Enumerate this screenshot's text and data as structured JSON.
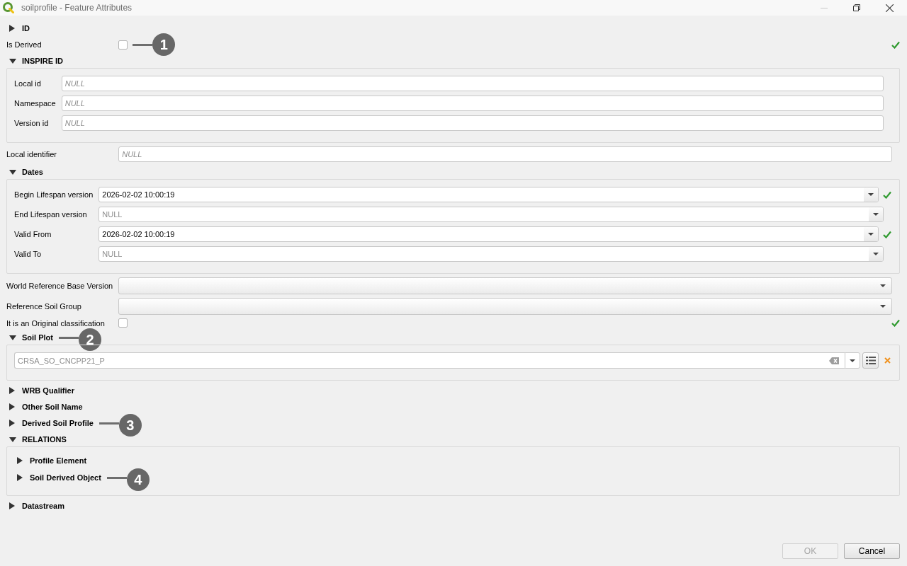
{
  "window": {
    "title": "soilprofile - Feature Attributes",
    "controls": [
      {
        "kind": "minimize",
        "disabled": true
      },
      {
        "kind": "restore",
        "disabled": false
      },
      {
        "kind": "close",
        "disabled": false
      }
    ]
  },
  "form": [
    {
      "kind": "group",
      "label": "ID",
      "expanded": false
    },
    {
      "kind": "checkbox",
      "label": "Is Derived",
      "checked": false,
      "valid": true,
      "callout": "1"
    },
    {
      "kind": "group",
      "label": "INSPIRE ID",
      "expanded": true,
      "children": [
        {
          "kind": "text",
          "label": "Local id",
          "placeholder": "NULL"
        },
        {
          "kind": "text",
          "label": "Namespace",
          "placeholder": "NULL"
        },
        {
          "kind": "text",
          "label": "Version id",
          "placeholder": "NULL"
        }
      ]
    },
    {
      "kind": "text",
      "label": "Local identifier",
      "placeholder": "NULL"
    },
    {
      "kind": "group",
      "label": "Dates",
      "expanded": true,
      "children": [
        {
          "kind": "datetime",
          "label": "Begin Lifespan version",
          "value": "2026-02-02 10:00:19",
          "valid": true
        },
        {
          "kind": "datetime",
          "label": "End Lifespan version",
          "placeholder": "NULL"
        },
        {
          "kind": "datetime",
          "label": "Valid From",
          "value": "2026-02-02 10:00:19",
          "valid": true
        },
        {
          "kind": "datetime",
          "label": "Valid To",
          "placeholder": "NULL"
        }
      ]
    },
    {
      "kind": "combo",
      "label": "World Reference Base Version"
    },
    {
      "kind": "combo",
      "label": "Reference Soil Group"
    },
    {
      "kind": "checkbox",
      "label": "It is an Original classification",
      "checked": false,
      "valid": true
    },
    {
      "kind": "group",
      "label": "Soil Plot",
      "expanded": true,
      "callout": "2",
      "children": [
        {
          "kind": "relation",
          "value": "CRSA_SO_CNCPP21_P",
          "valid": false
        }
      ]
    },
    {
      "kind": "group",
      "label": "WRB Qualifier",
      "expanded": false
    },
    {
      "kind": "group",
      "label": "Other Soil Name",
      "expanded": false
    },
    {
      "kind": "group",
      "label": "Derived Soil Profile",
      "expanded": false,
      "callout": "3"
    },
    {
      "kind": "group",
      "label": "RELATIONS",
      "expanded": true,
      "children": [
        {
          "kind": "group",
          "label": "Profile Element",
          "expanded": false
        },
        {
          "kind": "group",
          "label": "Soil Derived Object",
          "expanded": false,
          "callout": "4"
        }
      ]
    },
    {
      "kind": "group",
      "label": "Datastream",
      "expanded": false
    }
  ],
  "buttons": [
    {
      "label": "OK",
      "disabled": true
    },
    {
      "label": "Cancel",
      "disabled": false
    }
  ]
}
